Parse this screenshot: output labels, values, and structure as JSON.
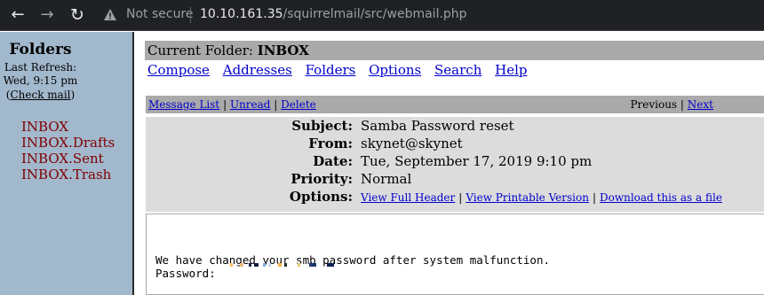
{
  "browser": {
    "security_label": "Not secure",
    "url_host": "10.10.161.35",
    "url_path": "/squirrelmail/src/webmail.php"
  },
  "sidebar": {
    "title": "Folders",
    "refresh_label": "Last Refresh:",
    "refresh_time": "Wed, 9:15 pm",
    "check_mail": "Check mail",
    "folders": [
      "INBOX",
      "INBOX.Drafts",
      "INBOX.Sent",
      "INBOX.Trash"
    ]
  },
  "main": {
    "current_folder_label": "Current Folder: ",
    "current_folder": "INBOX",
    "menu": [
      "Compose",
      "Addresses",
      "Folders",
      "Options",
      "Search",
      "Help"
    ],
    "message_nav": {
      "message_list": "Message List",
      "unread": "Unread",
      "delete": "Delete",
      "previous": "Previous",
      "next": "Next"
    },
    "headers": {
      "subject_label": "Subject:",
      "subject": "Samba Password reset",
      "from_label": "From:",
      "from": "skynet@skynet",
      "date_label": "Date:",
      "date": "Tue, September 17, 2019 9:10 pm",
      "priority_label": "Priority:",
      "priority": "Normal",
      "options_label": "Options:",
      "view_full_header": "View Full Header",
      "view_printable": "View Printable Version",
      "download": "Download this as a file"
    },
    "body": {
      "line1": "We have changed your smb password after system malfunction.",
      "line2": "Password: "
    }
  }
}
